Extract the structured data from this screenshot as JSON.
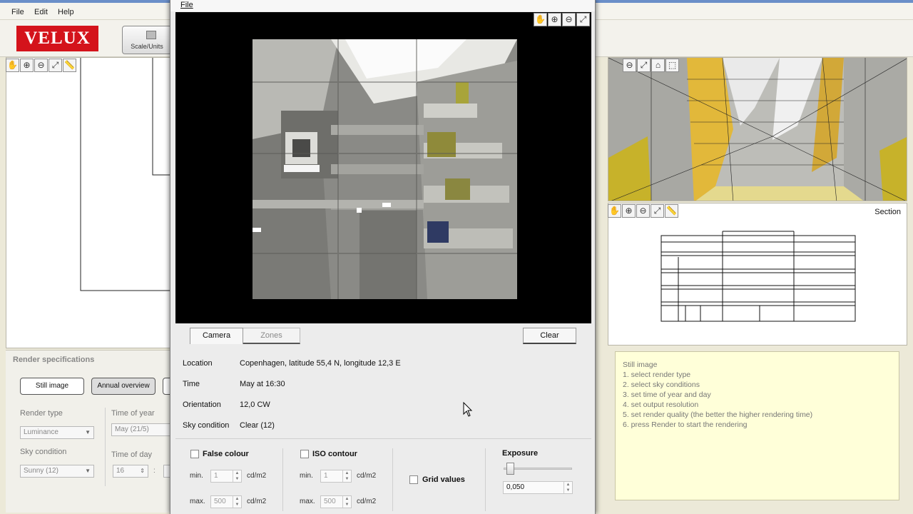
{
  "app": {
    "menu": [
      "File",
      "Edit",
      "Help"
    ],
    "logo": "VELUX",
    "toolbar_button": "Scale/Units"
  },
  "colors": {
    "brand_red": "#d4131b",
    "help_background": "#ffffd9",
    "render_background": "#000000"
  },
  "views": {
    "section_label": "Section",
    "plan_tools": [
      "hand-icon",
      "zoom-in-icon",
      "zoom-out-icon",
      "fit-icon",
      "ruler-icon"
    ],
    "view3d_tools": [
      "zoom-out-icon",
      "fit-icon",
      "perspective-icon",
      "box-icon"
    ],
    "section_tools": [
      "hand-icon",
      "zoom-in-icon",
      "zoom-out-icon",
      "fit-icon",
      "ruler-icon"
    ]
  },
  "render_spec": {
    "title": "Render specifications",
    "buttons": [
      "Still image",
      "Annual overview"
    ],
    "render_type_label": "Render type",
    "render_type_value": "Luminance",
    "sky_condition_label": "Sky condition",
    "sky_condition_value": "Sunny (12)",
    "time_of_year_label": "Time of year",
    "time_of_year_value": "May (21/5)",
    "time_of_day_label": "Time of day",
    "time_of_day_value": "16",
    "time_separator": ":"
  },
  "help": {
    "lines": [
      "Still image",
      "1. select render type",
      "2. select sky conditions",
      "3. set time of year and day",
      "4. set output resolution",
      "5. set render quality (the better the higher rendering time)",
      "6. press Render to start the rendering"
    ]
  },
  "dialog": {
    "menu_file": "File",
    "view_tools": [
      "hand-icon",
      "zoom-in-icon",
      "zoom-out-icon",
      "fit-icon"
    ],
    "tabs": [
      "Camera",
      "Zones"
    ],
    "active_tab": "Camera",
    "clear": "Clear",
    "info": {
      "location_label": "Location",
      "location_value": "Copenhagen, latitude 55,4 N, longitude 12,3 E",
      "time_label": "Time",
      "time_value": "May at 16:30",
      "orientation_label": "Orientation",
      "orientation_value": "12,0 CW",
      "sky_label": "Sky condition",
      "sky_value": "Clear (12)"
    },
    "false_colour": {
      "label": "False colour",
      "min_label": "min.",
      "min_value": "1",
      "max_label": "max.",
      "max_value": "500",
      "unit": "cd/m2"
    },
    "iso_contour": {
      "label": "ISO contour",
      "min_label": "min.",
      "min_value": "1",
      "max_label": "max.",
      "max_value": "500",
      "unit": "cd/m2"
    },
    "grid_values": "Grid values",
    "exposure": {
      "label": "Exposure",
      "value": "0,050",
      "slider_fraction": 0.05
    }
  }
}
